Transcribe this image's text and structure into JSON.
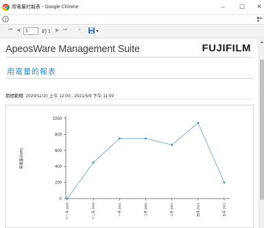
{
  "window": {
    "title": "用電量的報表 - Google Chrome",
    "min_glyph": "–",
    "max_glyph": "☐",
    "close_glyph": "×",
    "icon": "chrome-icon"
  },
  "address_bar": {
    "info_icon": "info-icon",
    "ext_icon": "extension-icon"
  },
  "toolbar": {
    "first_glyph": "⏮",
    "prev_glyph": "◀",
    "page_value": "1",
    "of_label": "的 1",
    "next_glyph": "▶",
    "last_glyph": "⏭",
    "find_glyph": "⌕",
    "export_icon": "export-save-icon"
  },
  "report": {
    "suite_title": "ApeosWare Management Suite",
    "brand": "FUJIFILM",
    "title": "用電量的報表",
    "period": "期間範疇: 2020/11/10 上午 12:00 - 2021/5/9 下午 11:59"
  },
  "chart_data": {
    "type": "line",
    "title": "",
    "xlabel": "",
    "ylabel": "用電量(kWh)",
    "ylim": [
      0,
      1000
    ],
    "yticks": [
      0,
      200,
      400,
      600,
      800,
      1000
    ],
    "grid": false,
    "categories": [
      "十一月 2020",
      "十二月 2020",
      "一月 2021",
      "二月 2021",
      "三月 2021",
      "四月 2021",
      "五月 2021"
    ],
    "series": [
      {
        "values": [
          0,
          450,
          750,
          750,
          670,
          945,
          200
        ]
      }
    ],
    "colors": {
      "line": "#7aaedc",
      "marker": "#4a90d9"
    }
  },
  "scroll": {
    "up_glyph": "▲"
  }
}
